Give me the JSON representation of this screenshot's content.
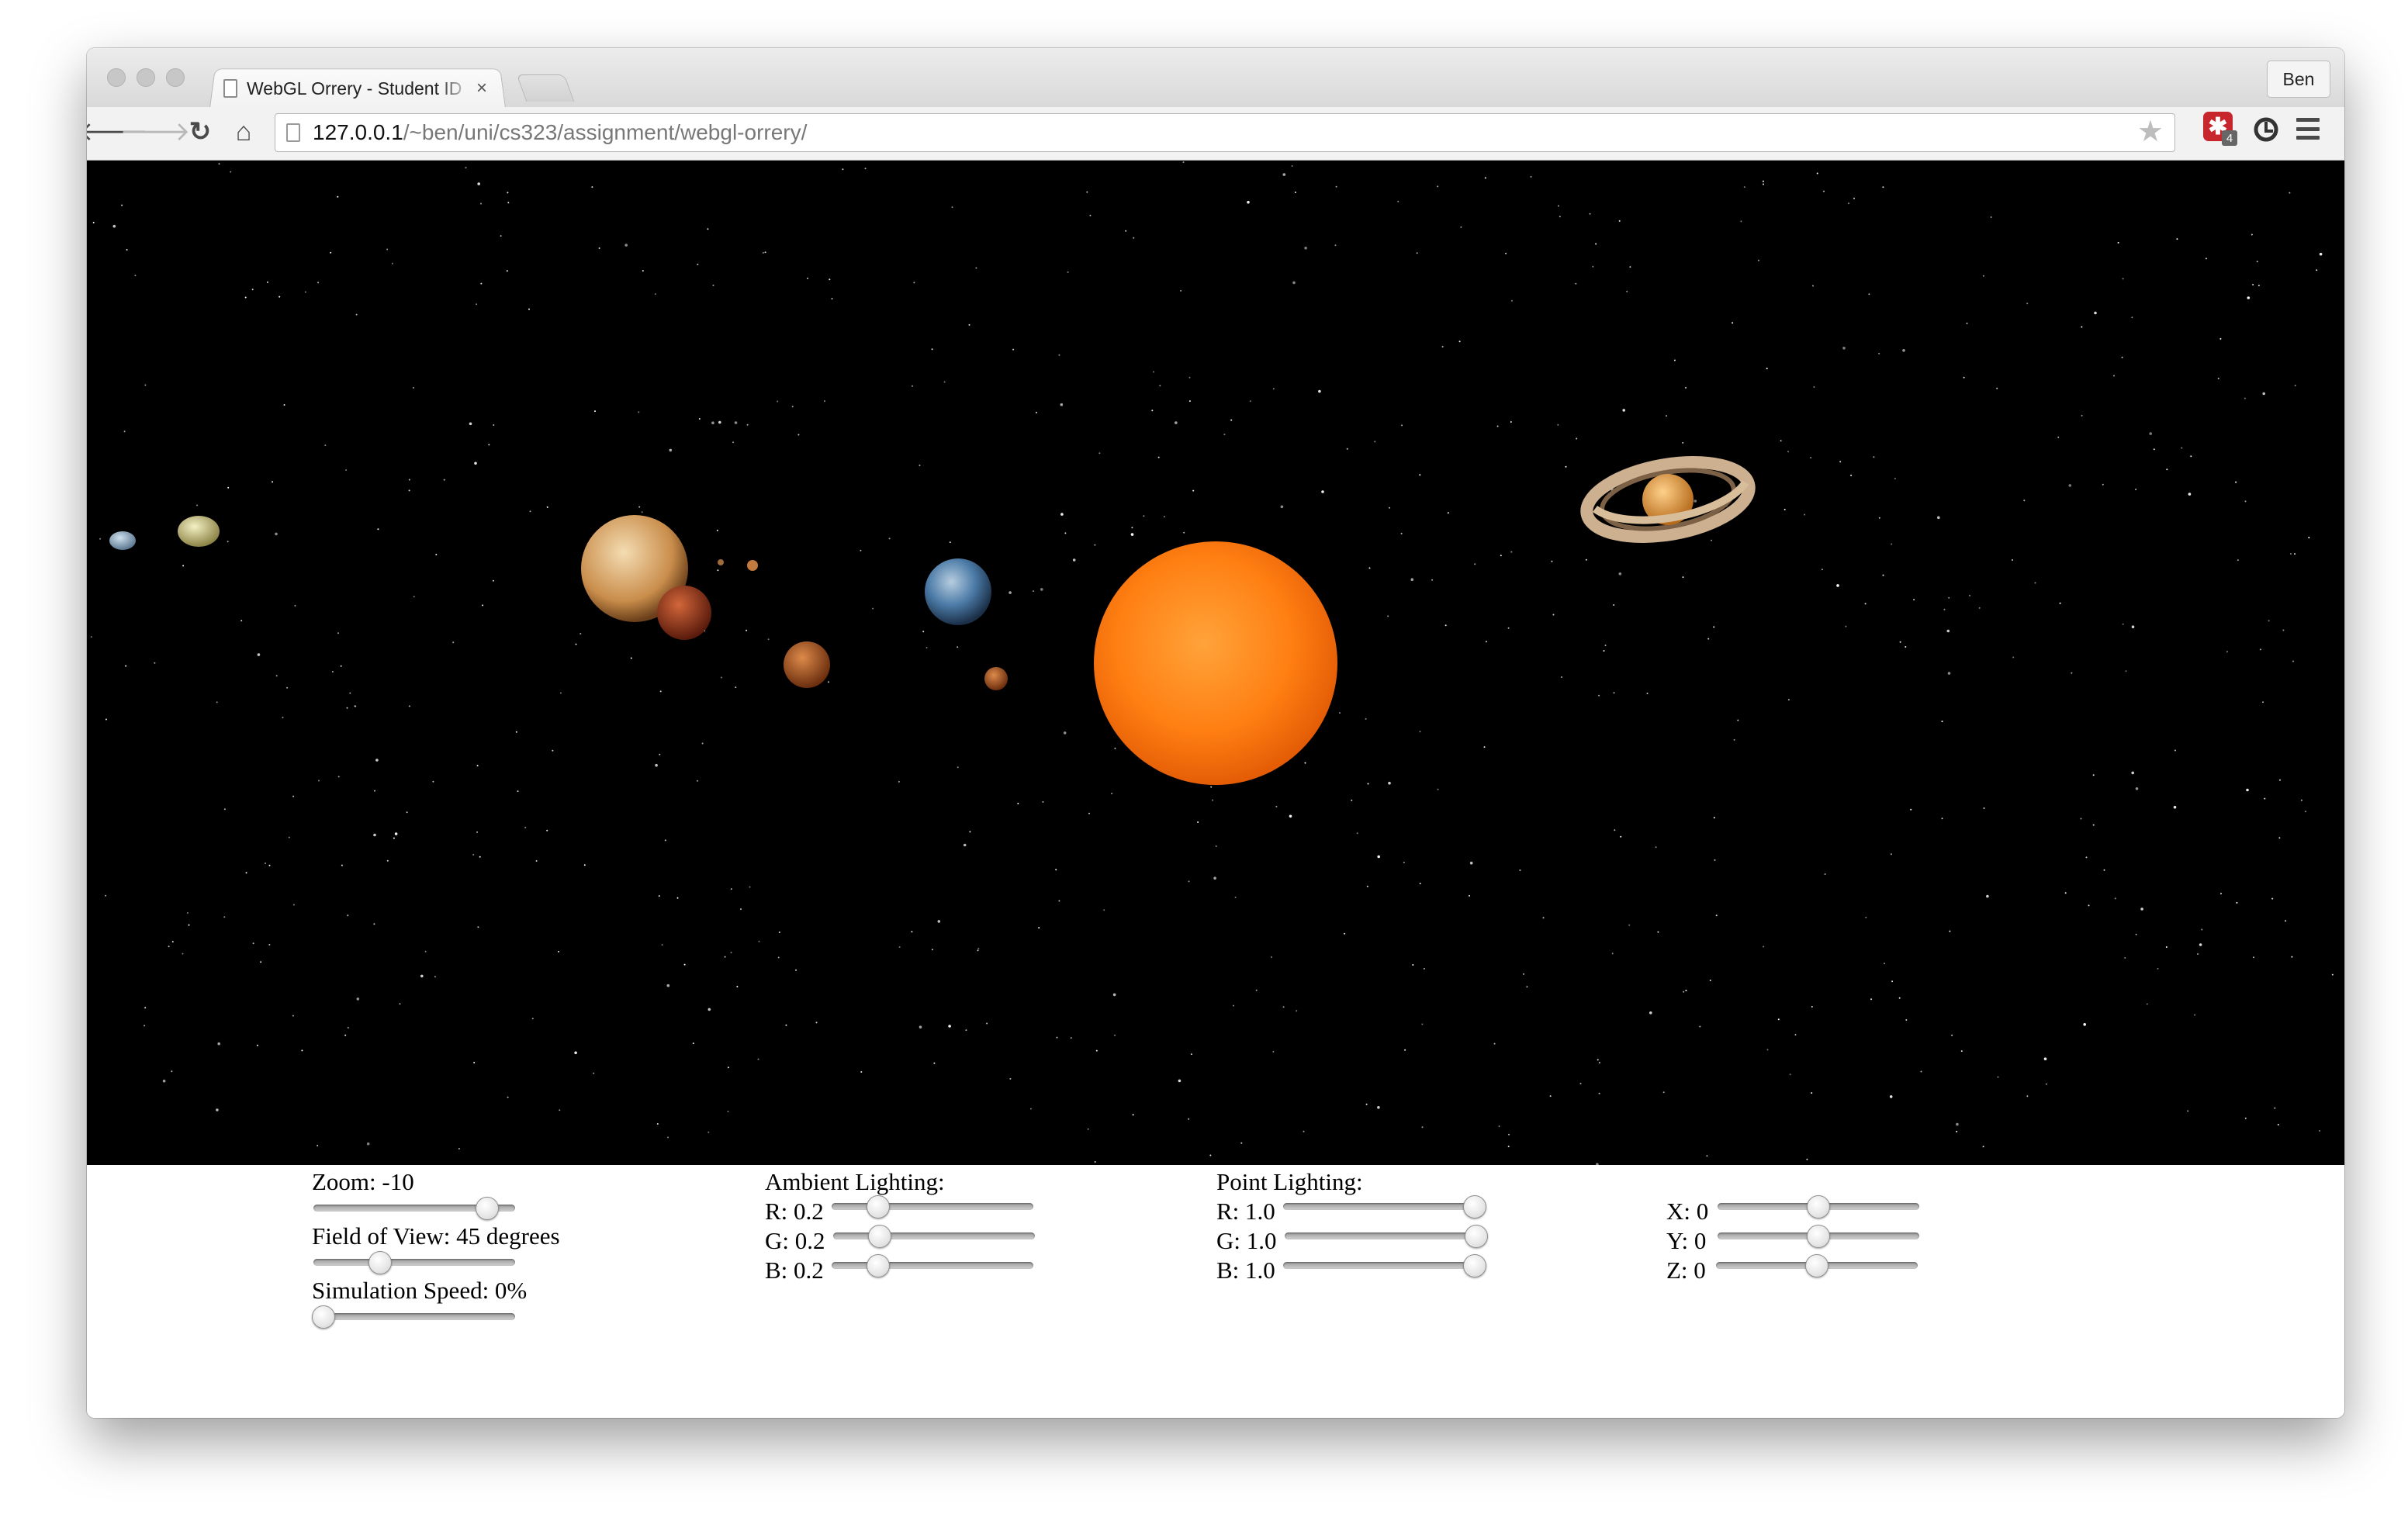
{
  "browser": {
    "tab_title": "WebGL Orrery - Student ID",
    "tab_close": "×",
    "profile_name": "Ben",
    "url_host": "127.0.0.1",
    "url_path": "/~ben/uni/cs323/assignment/webgl-orrery/",
    "extension_badge": "4",
    "nav": {
      "back": "🡐",
      "forward": "🡒",
      "reload": "↻",
      "home": "⌂"
    },
    "bookmark_icon": "★"
  },
  "controls": {
    "zoom": {
      "label": "Zoom: -10",
      "fraction": 0.86
    },
    "fov": {
      "label": "Field of View: 45 degrees",
      "fraction": 0.33
    },
    "speed": {
      "label": "Simulation Speed: 0%",
      "fraction": 0.05
    },
    "ambient": {
      "title": "Ambient Lighting:",
      "r": {
        "label": "R: 0.2",
        "fraction": 0.23
      },
      "g": {
        "label": "G: 0.2",
        "fraction": 0.23
      },
      "b": {
        "label": "B: 0.2",
        "fraction": 0.23
      }
    },
    "point": {
      "title": "Point Lighting:",
      "r": {
        "label": "R: 1.0",
        "fraction": 0.95
      },
      "g": {
        "label": "G: 1.0",
        "fraction": 0.95
      },
      "b": {
        "label": "B: 1.0",
        "fraction": 0.95
      }
    },
    "position": {
      "x": {
        "label": "X: 0",
        "fraction": 0.5
      },
      "y": {
        "label": "Y: 0",
        "fraction": 0.5
      },
      "z": {
        "label": "Z: 0",
        "fraction": 0.5
      }
    }
  },
  "colors": {
    "sun": "#ff7a12",
    "saturn": "#e49a3c",
    "earth": "#3d6f9c",
    "mars": "#b5471c",
    "jupiter": "#d9a36a",
    "background": "#000000"
  }
}
